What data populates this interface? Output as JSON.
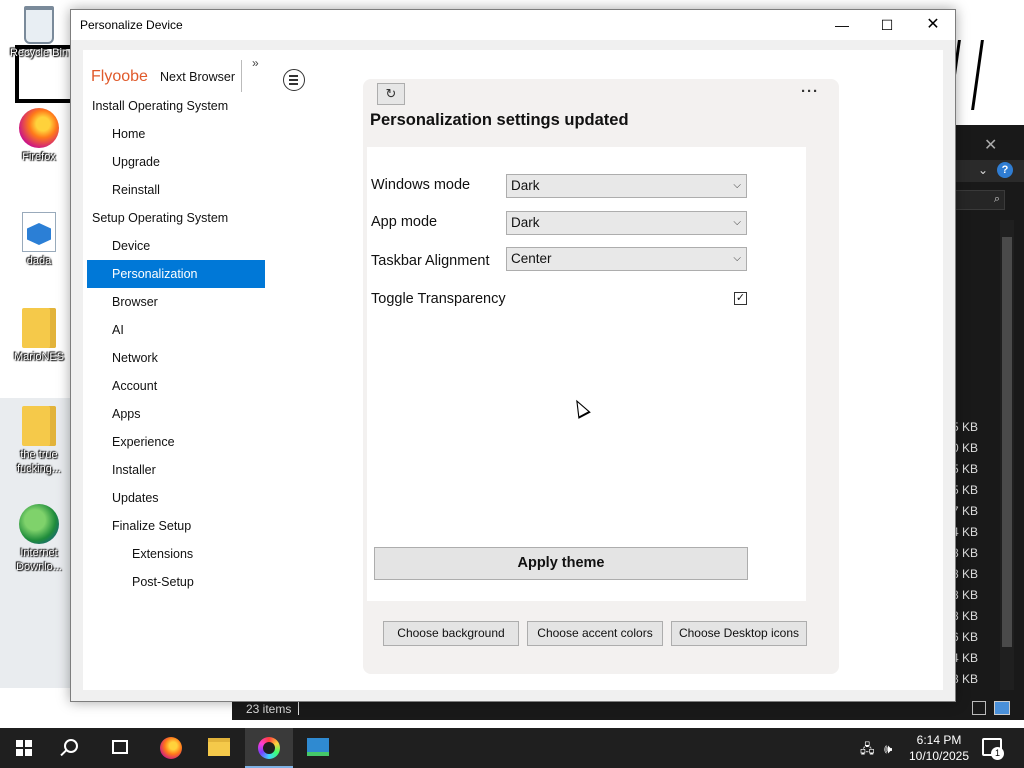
{
  "desktop": {
    "icons": [
      {
        "label": "Recycle Bin"
      },
      {
        "label": "Firefox"
      },
      {
        "label": "dada"
      },
      {
        "label": "MarioNES"
      },
      {
        "label": "the true fucking..."
      },
      {
        "label": "Internet Downlo..."
      }
    ]
  },
  "explorer": {
    "file_sizes": [
      "5 KB",
      "0 KB",
      "5 KB",
      "5 KB",
      "7 KB",
      "4 KB",
      "8 KB",
      "8 KB",
      "8 KB",
      "8 KB",
      "6 KB",
      "4 KB",
      "8 KB"
    ],
    "status_items": "23 items"
  },
  "window": {
    "title": "Personalize Device",
    "controls": {
      "minimize": "—",
      "maximize": "☐",
      "close": "✕"
    }
  },
  "sidebar": {
    "brand": "Flyoobe",
    "next_browser": "Next Browser",
    "expand_icon": "»",
    "items": [
      {
        "label": "Install Operating System",
        "level": 0
      },
      {
        "label": "Home",
        "level": 1
      },
      {
        "label": "Upgrade",
        "level": 1
      },
      {
        "label": "Reinstall",
        "level": 1
      },
      {
        "label": "Setup Operating System",
        "level": 0
      },
      {
        "label": "Device",
        "level": 1
      },
      {
        "label": "Personalization",
        "level": 1,
        "selected": true
      },
      {
        "label": "Browser",
        "level": 1
      },
      {
        "label": "AI",
        "level": 1
      },
      {
        "label": "Network",
        "level": 1
      },
      {
        "label": "Account",
        "level": 1
      },
      {
        "label": "Apps",
        "level": 1
      },
      {
        "label": "Experience",
        "level": 1
      },
      {
        "label": "Installer",
        "level": 1
      },
      {
        "label": "Updates",
        "level": 1
      },
      {
        "label": "Finalize Setup",
        "level": 1
      },
      {
        "label": "Extensions",
        "level": 2
      },
      {
        "label": "Post-Setup",
        "level": 2
      }
    ]
  },
  "panel": {
    "refresh_icon": "↻",
    "more_icon": "···",
    "title": "Personalization settings updated",
    "settings": [
      {
        "label": "Windows mode",
        "value": "Dark"
      },
      {
        "label": "App mode",
        "value": "Dark"
      },
      {
        "label": "Taskbar Alignment",
        "value": "Center"
      }
    ],
    "toggle_label": "Toggle Transparency",
    "toggle_checked": true,
    "apply_button": "Apply theme",
    "bottom_buttons": [
      "Choose background",
      "Choose accent colors",
      "Choose Desktop icons"
    ]
  },
  "taskbar": {
    "time": "6:14 PM",
    "date": "10/10/2025",
    "notification_count": "1",
    "accent_color": "#0078d7"
  }
}
